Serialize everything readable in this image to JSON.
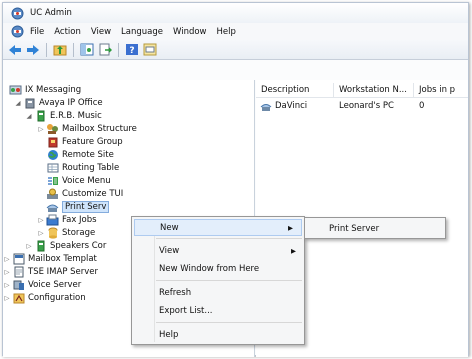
{
  "window": {
    "title": "UC Admin"
  },
  "menubar": {
    "items": [
      "File",
      "Action",
      "View",
      "Language",
      "Window",
      "Help"
    ]
  },
  "toolbar": {
    "buttons": [
      "back-arrow-icon",
      "forward-arrow-icon",
      "up-folder-icon",
      "console-tree-icon",
      "export-list-icon",
      "help-icon",
      "properties-icon"
    ]
  },
  "tree": {
    "root": "IX Messaging",
    "office": "Avaya IP Office",
    "site": "E.R.B. Music",
    "items": [
      "Mailbox Structure",
      "Feature Group",
      "Remote Site",
      "Routing Table",
      "Voice Menu",
      "Customize TUI",
      "Print Serv",
      "Fax Jobs",
      "Storage"
    ],
    "siblings": [
      "Speakers Cor"
    ],
    "top": [
      "Mailbox Templat",
      "TSE IMAP Server",
      "Voice Server",
      "Configuration"
    ]
  },
  "list": {
    "columns": [
      "Description",
      "Workstation N...",
      "Jobs in p"
    ],
    "rows": [
      {
        "description": "DaVinci",
        "workstation": "Leonard's PC",
        "jobs": "0"
      }
    ]
  },
  "context_menu": {
    "items": [
      "New",
      "View",
      "New Window from Here",
      "Refresh",
      "Export List...",
      "Help"
    ],
    "submenu": [
      "Print Server"
    ]
  }
}
